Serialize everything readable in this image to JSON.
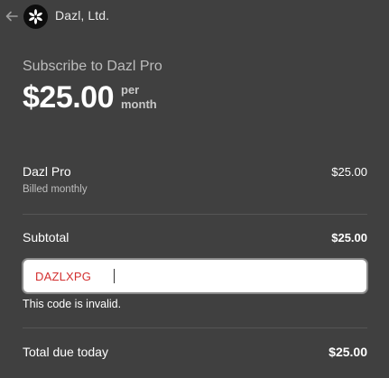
{
  "header": {
    "back_icon": "arrow-left-icon",
    "logo_icon": "dazl-logo-icon",
    "merchant_name": "Dazl, Ltd."
  },
  "product": {
    "subscribe_title": "Subscribe to Dazl Pro",
    "price": "$25.00",
    "period_line1": "per",
    "period_line2": "month"
  },
  "line_items": [
    {
      "name": "Dazl Pro",
      "billing": "Billed monthly",
      "amount": "$25.00"
    }
  ],
  "subtotal": {
    "label": "Subtotal",
    "amount": "$25.00"
  },
  "promo": {
    "value": "DAZLXPG",
    "error": "This code is invalid."
  },
  "total": {
    "label": "Total due today",
    "amount": "$25.00"
  },
  "colors": {
    "background": "#404040",
    "error_text": "#d32f2f",
    "muted_text": "#bdbdbd"
  }
}
